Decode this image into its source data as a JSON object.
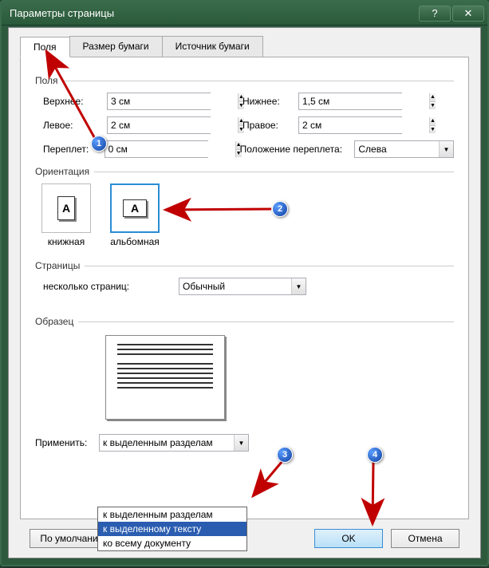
{
  "window": {
    "title": "Параметры страницы"
  },
  "tabs": [
    {
      "label": "Поля",
      "active": true
    },
    {
      "label": "Размер бумаги",
      "active": false
    },
    {
      "label": "Источник бумаги",
      "active": false
    }
  ],
  "groups": {
    "margins": {
      "title": "Поля"
    },
    "orientation": {
      "title": "Ориентация"
    },
    "pages": {
      "title": "Страницы"
    },
    "preview": {
      "title": "Образец"
    }
  },
  "fields": {
    "top": {
      "label": "Верхнее:",
      "value": "3 см"
    },
    "bottom": {
      "label": "Нижнее:",
      "value": "1,5 см"
    },
    "left": {
      "label": "Левое:",
      "value": "2 см"
    },
    "right": {
      "label": "Правое:",
      "value": "2 см"
    },
    "gutter": {
      "label": "Переплет:",
      "value": "0 см"
    },
    "gutter_pos": {
      "label": "Положение переплета:",
      "value": "Слева"
    },
    "multi_pages": {
      "label": "несколько страниц:",
      "value": "Обычный"
    },
    "apply_to": {
      "label": "Применить:",
      "value": "к выделенным разделам"
    }
  },
  "orientation": {
    "portrait": {
      "label": "книжная"
    },
    "landscape": {
      "label": "альбомная"
    }
  },
  "apply_options": [
    "к выделенным разделам",
    "к выделенному тексту",
    "ко всему документу"
  ],
  "buttons": {
    "default": "По умолчанию…",
    "ok": "OK",
    "cancel": "Отмена"
  },
  "badges": {
    "b1": "1",
    "b2": "2",
    "b3": "3",
    "b4": "4"
  },
  "titlebar": {
    "help": "?",
    "close": "✕"
  }
}
